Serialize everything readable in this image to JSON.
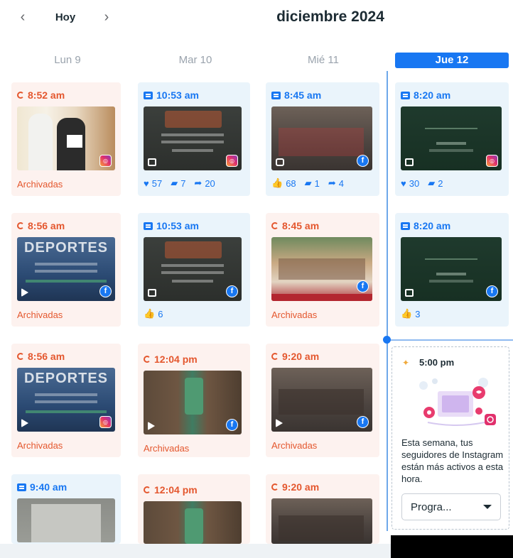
{
  "header": {
    "prev": "‹",
    "today": "Hoy",
    "next": "›",
    "month": "diciembre 2024"
  },
  "days": [
    "Lun 9",
    "Mar 10",
    "Mié 11",
    "Jue 12"
  ],
  "posts": {
    "lun_1": {
      "time": "8:52 am",
      "status": "Archivadas"
    },
    "lun_2": {
      "time": "8:56 am",
      "status": "Archivadas",
      "thumb_text": "DEPORTES"
    },
    "lun_3": {
      "time": "8:56 am",
      "status": "Archivadas",
      "thumb_text": "DEPORTES"
    },
    "lun_4": {
      "time": "9:40 am"
    },
    "mar_1": {
      "time": "10:53 am",
      "likes": "57",
      "comments": "7",
      "shares": "20"
    },
    "mar_2": {
      "time": "10:53 am",
      "likes": "6"
    },
    "mar_3": {
      "time": "12:04 pm",
      "status": "Archivadas"
    },
    "mar_4": {
      "time": "12:04 pm"
    },
    "mie_1": {
      "time": "8:45 am",
      "likes": "68",
      "comments": "1",
      "shares": "4"
    },
    "mie_2": {
      "time": "8:45 am",
      "status": "Archivadas"
    },
    "mie_3": {
      "time": "9:20 am",
      "status": "Archivadas"
    },
    "mie_4": {
      "time": "9:20 am"
    },
    "jue_1": {
      "time": "8:20 am",
      "likes": "30",
      "comments": "2"
    },
    "jue_2": {
      "time": "8:20 am",
      "likes": "3"
    }
  },
  "recommendation": {
    "time": "5:00 pm",
    "text": "Esta semana, tus seguidores de Instagram están más activos a esta hora.",
    "button": "Progra..."
  }
}
